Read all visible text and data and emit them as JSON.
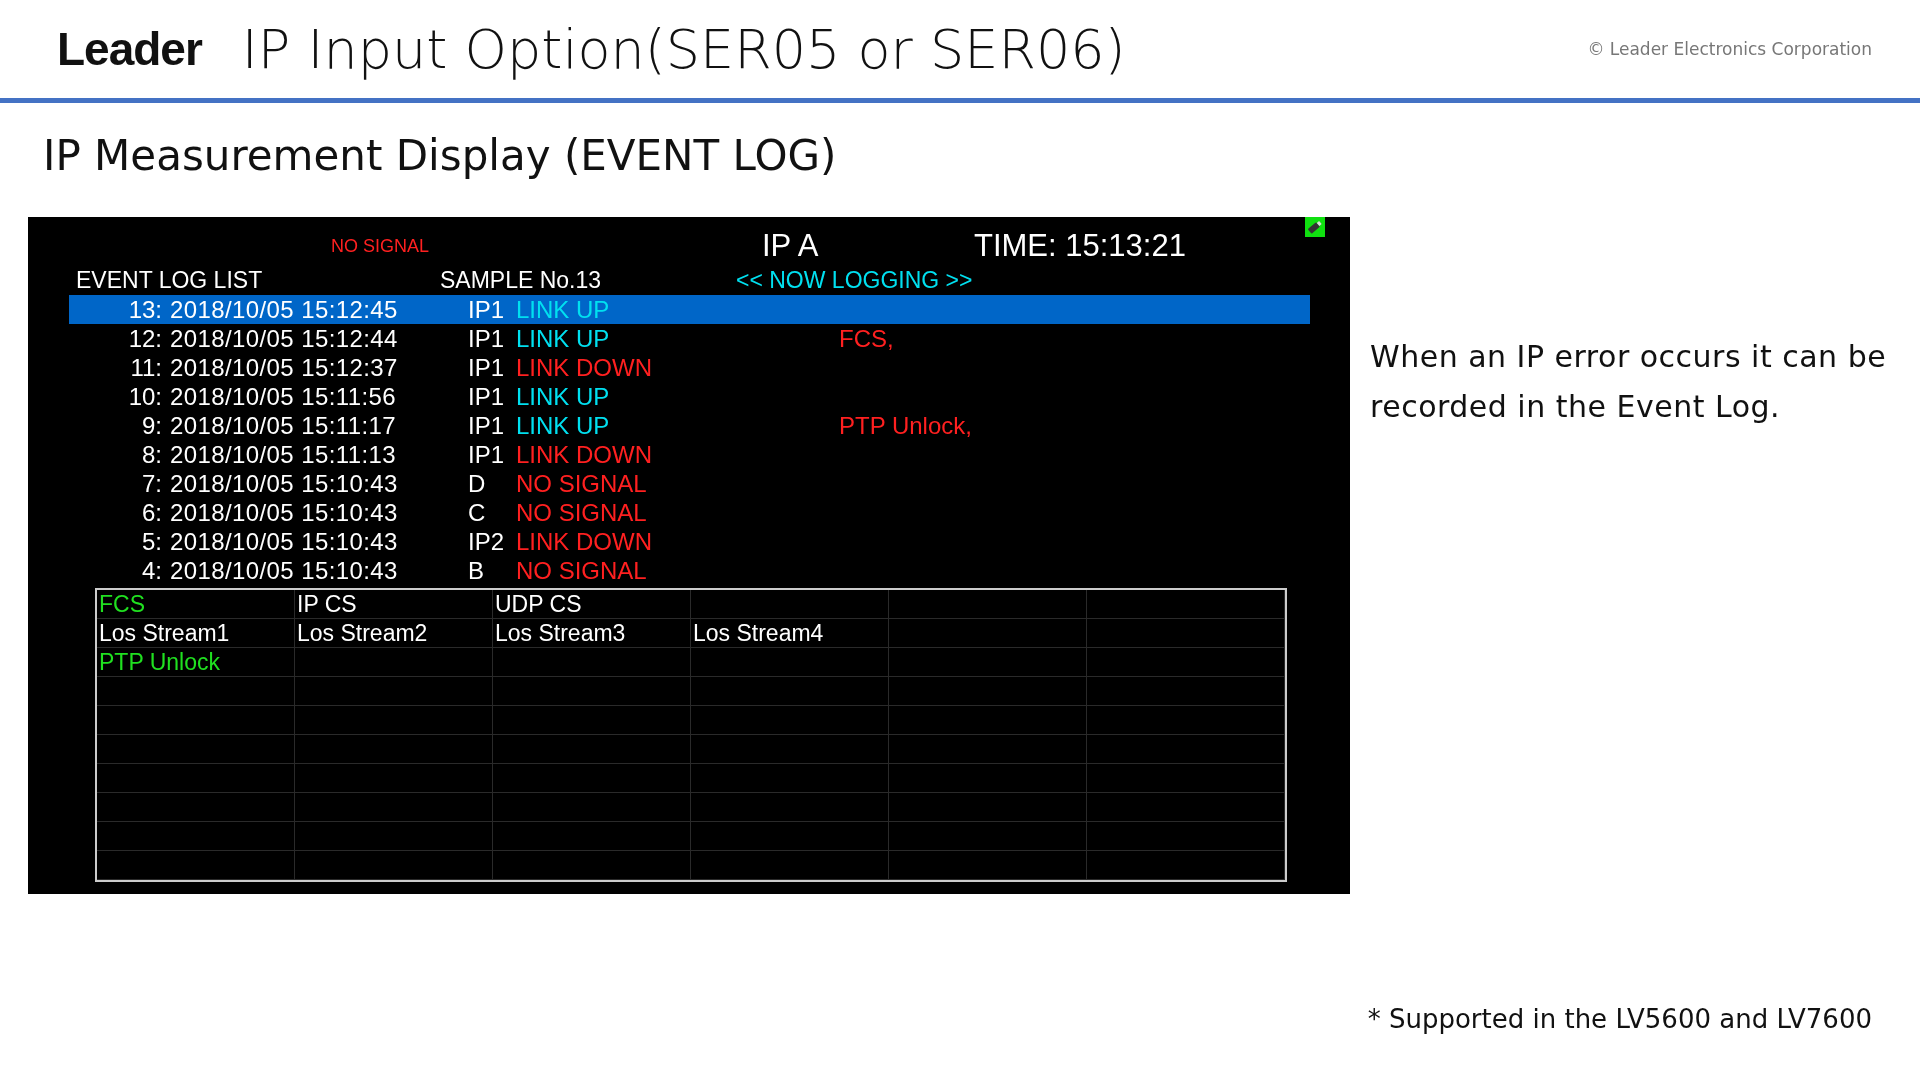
{
  "header": {
    "logo": "Leader",
    "title": "IP Input Option(SER05 or SER06)",
    "copyright": "© Leader Electronics Corporation"
  },
  "subtitle": "IP Measurement Display (EVENT LOG)",
  "display": {
    "status": "NO SIGNAL",
    "input": "IP A",
    "time": "TIME: 15:13:21",
    "list_title": "EVENT LOG LIST",
    "sample": "SAMPLE No.13",
    "logging": "<< NOW LOGGING >>",
    "rows": [
      {
        "no": "13:",
        "timestamp": "2018/10/05 15:12:45",
        "source": "IP1",
        "event": "LINK UP",
        "kind": "good",
        "detail": "",
        "selected": true
      },
      {
        "no": "12:",
        "timestamp": "2018/10/05 15:12:44",
        "source": "IP1",
        "event": "LINK UP",
        "kind": "good",
        "detail": "FCS,",
        "selected": false
      },
      {
        "no": "11:",
        "timestamp": "2018/10/05 15:12:37",
        "source": "IP1",
        "event": "LINK DOWN",
        "kind": "bad",
        "detail": "",
        "selected": false
      },
      {
        "no": "10:",
        "timestamp": "2018/10/05 15:11:56",
        "source": "IP1",
        "event": "LINK UP",
        "kind": "good",
        "detail": "",
        "selected": false
      },
      {
        "no": "9:",
        "timestamp": "2018/10/05 15:11:17",
        "source": "IP1",
        "event": "LINK UP",
        "kind": "good",
        "detail": "PTP Unlock,",
        "selected": false
      },
      {
        "no": "8:",
        "timestamp": "2018/10/05 15:11:13",
        "source": "IP1",
        "event": "LINK DOWN",
        "kind": "bad",
        "detail": "",
        "selected": false
      },
      {
        "no": "7:",
        "timestamp": "2018/10/05 15:10:43",
        "source": "D",
        "event": "NO SIGNAL",
        "kind": "bad",
        "detail": "",
        "selected": false
      },
      {
        "no": "6:",
        "timestamp": "2018/10/05 15:10:43",
        "source": "C",
        "event": "NO SIGNAL",
        "kind": "bad",
        "detail": "",
        "selected": false
      },
      {
        "no": "5:",
        "timestamp": "2018/10/05 15:10:43",
        "source": "IP2",
        "event": "LINK DOWN",
        "kind": "bad",
        "detail": "",
        "selected": false
      },
      {
        "no": "4:",
        "timestamp": "2018/10/05 15:10:43",
        "source": "B",
        "event": "NO SIGNAL",
        "kind": "bad",
        "detail": "",
        "selected": false
      }
    ],
    "error_grid": [
      [
        {
          "label": "FCS",
          "active": true
        },
        {
          "label": "IP CS",
          "active": false
        },
        {
          "label": "UDP CS",
          "active": false
        }
      ],
      [
        {
          "label": "Los Stream1",
          "active": false
        },
        {
          "label": "Los Stream2",
          "active": false
        },
        {
          "label": "Los Stream3",
          "active": false
        },
        {
          "label": "Los Stream4",
          "active": false
        }
      ],
      [
        {
          "label": "PTP Unlock",
          "active": true
        }
      ]
    ]
  },
  "description": "When an IP error occurs it can be recorded in the Event Log.",
  "footnote": "* Supported in the LV5600 and LV7600"
}
